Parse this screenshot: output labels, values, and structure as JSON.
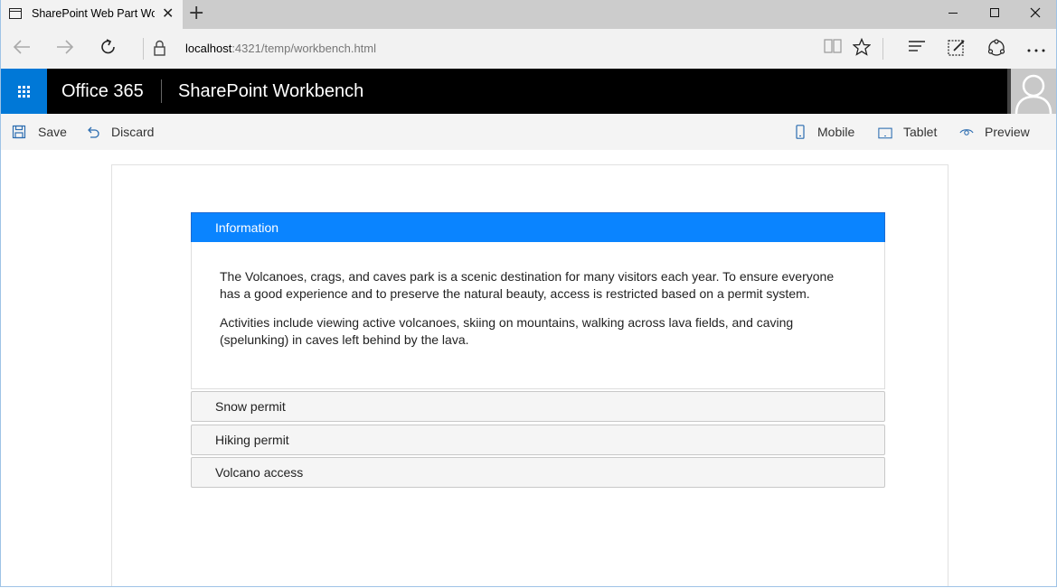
{
  "browser": {
    "tab_title": "SharePoint Web Part Workbench",
    "tab_close": "✕",
    "new_tab": "+",
    "url_host": "localhost",
    "url_rest": ":4321/temp/workbench.html"
  },
  "suite": {
    "brand": "Office 365",
    "app_title": "SharePoint Workbench"
  },
  "toolbar": {
    "save_label": "Save",
    "discard_label": "Discard",
    "mobile_label": "Mobile",
    "tablet_label": "Tablet",
    "preview_label": "Preview"
  },
  "accordion": {
    "active": {
      "title": "Information",
      "paragraphs": [
        "The Volcanoes, crags, and caves park is a scenic destination for many visitors each year. To ensure everyone has a good experience and to preserve the natural beauty, access is restricted based on a permit system.",
        "Activities include viewing active volcanoes, skiing on mountains, walking across lava fields, and caving (spelunking) in caves left behind by the lava."
      ]
    },
    "collapsed": [
      {
        "title": "Snow permit"
      },
      {
        "title": "Hiking permit"
      },
      {
        "title": "Volcano access"
      }
    ]
  },
  "colors": {
    "accent": "#0a84ff",
    "waffle": "#0078d7",
    "suitebar": "#000000"
  }
}
